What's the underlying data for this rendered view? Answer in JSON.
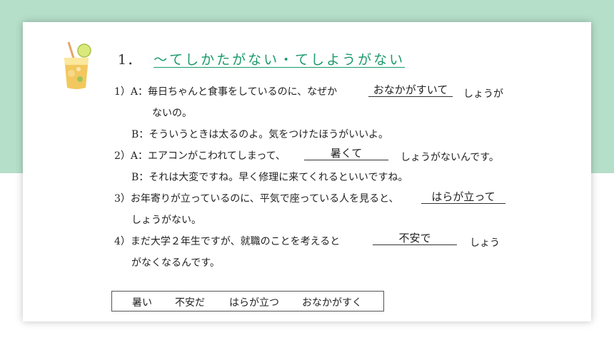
{
  "section": {
    "number": "1．",
    "title": "～てしかたがない・てしようがない"
  },
  "items": [
    {
      "a_prefix": "1）A：毎日ちゃんと食事をしているのに、なぜか",
      "answer": "おなかがすいて",
      "a_suffix": "しょうが",
      "a_cont": "ないの。",
      "b_text": "B：そういうときは太るのよ。気をつけたほうがいいよ。"
    },
    {
      "a_prefix": "2）A：エアコンがこわれてしまって、",
      "answer": "暑くて",
      "a_suffix": "しょうがないんです。",
      "b_text": "B：それは大変ですね。早く修理に来てくれるといいですね。"
    },
    {
      "a_prefix": "3）お年寄りが立っているのに、平気で座っている人を見ると、",
      "answer": "はらが立って",
      "a_cont": "しょうがない。"
    },
    {
      "a_prefix": "4）まだ大学２年生ですが、就職のことを考えると",
      "answer": "不安で",
      "a_suffix": "しょう",
      "a_cont": "がなくなるんです。"
    }
  ],
  "choices": [
    "暑い",
    "不安だ",
    "はらが立つ",
    "おなかがすく"
  ]
}
